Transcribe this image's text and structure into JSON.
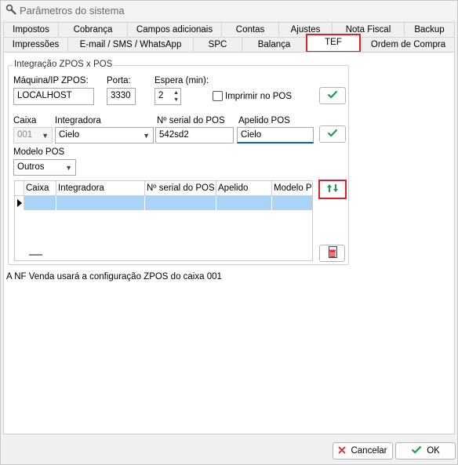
{
  "window": {
    "title": "Parâmetros do sistema"
  },
  "tabs": {
    "row1": [
      "Impostos",
      "Cobrança",
      "Campos adicionais",
      "Contas",
      "Ajustes",
      "Nota Fiscal",
      "Backup"
    ],
    "row2": [
      "Impressões",
      "E-mail / SMS / WhatsApp",
      "SPC",
      "Balança",
      "TEF",
      "Ordem de Compra"
    ],
    "active": "TEF"
  },
  "group": {
    "title": "Integração ZPOS x POS"
  },
  "server": {
    "host_label": "Máquina/IP ZPOS:",
    "host_value": "LOCALHOST",
    "port_label": "Porta:",
    "port_value": "3330",
    "wait_label": "Espera (min):",
    "wait_value": "2",
    "print_label": "Imprimir no POS",
    "print_checked": false
  },
  "pos_form": {
    "caixa_label": "Caixa",
    "caixa_value": "001",
    "integradora_label": "Integradora",
    "integradora_value": "Cielo",
    "serial_label": "Nº serial do POS",
    "serial_value": "542sd2",
    "apelido_label": "Apelido POS",
    "apelido_value": "Cielo",
    "modelo_label": "Modelo POS",
    "modelo_value": "Outros"
  },
  "grid": {
    "columns": [
      "Caixa",
      "Integradora",
      "Nº serial do POS",
      "Apelido",
      "Modelo PC"
    ],
    "rows": [
      [
        "",
        "",
        "",
        "",
        ""
      ]
    ]
  },
  "info_text": "A NF Venda usará a configuração ZPOS do caixa 001",
  "buttons": {
    "cancel": "Cancelar",
    "ok": "OK"
  },
  "colors": {
    "highlight": "#e01f26",
    "selection": "#a9d3f7",
    "check": "#1a9a4a"
  }
}
